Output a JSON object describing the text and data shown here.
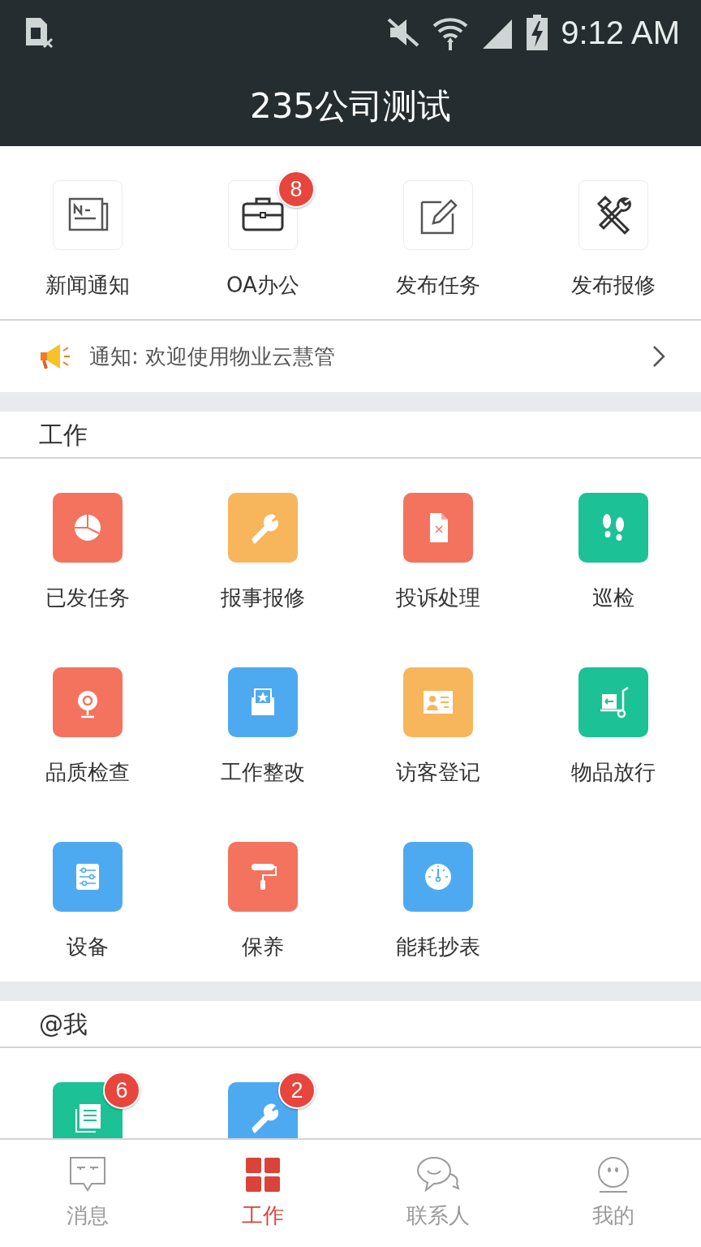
{
  "status_bar": {
    "time": "9:12 AM"
  },
  "title": "235公司测试",
  "quick_actions": [
    {
      "label": "新闻通知"
    },
    {
      "label": "OA办公",
      "badge": "8"
    },
    {
      "label": "发布任务"
    },
    {
      "label": "发布报修"
    }
  ],
  "notice": {
    "text": "通知: 欢迎使用物业云慧管"
  },
  "work_section": {
    "title": "工作",
    "items": [
      {
        "label": "已发任务",
        "color": "#f3735e"
      },
      {
        "label": "报事报修",
        "color": "#f7b55c"
      },
      {
        "label": "投诉处理",
        "color": "#f3735e"
      },
      {
        "label": "巡检",
        "color": "#1cc195"
      },
      {
        "label": "品质检查",
        "color": "#f3735e"
      },
      {
        "label": "工作整改",
        "color": "#4eaaf0"
      },
      {
        "label": "访客登记",
        "color": "#f7b55c"
      },
      {
        "label": "物品放行",
        "color": "#1cc195"
      },
      {
        "label": "设备",
        "color": "#4eaaf0"
      },
      {
        "label": "保养",
        "color": "#f3735e"
      },
      {
        "label": "能耗抄表",
        "color": "#4eaaf0"
      }
    ]
  },
  "at_me_section": {
    "title": "@我",
    "items": [
      {
        "color": "#1cc195",
        "badge": "6"
      },
      {
        "color": "#4eaaf0",
        "badge": "2"
      }
    ]
  },
  "tabs": [
    {
      "label": "消息",
      "selected": false
    },
    {
      "label": "工作",
      "selected": true
    },
    {
      "label": "联系人",
      "selected": false
    },
    {
      "label": "我的",
      "selected": false
    }
  ]
}
